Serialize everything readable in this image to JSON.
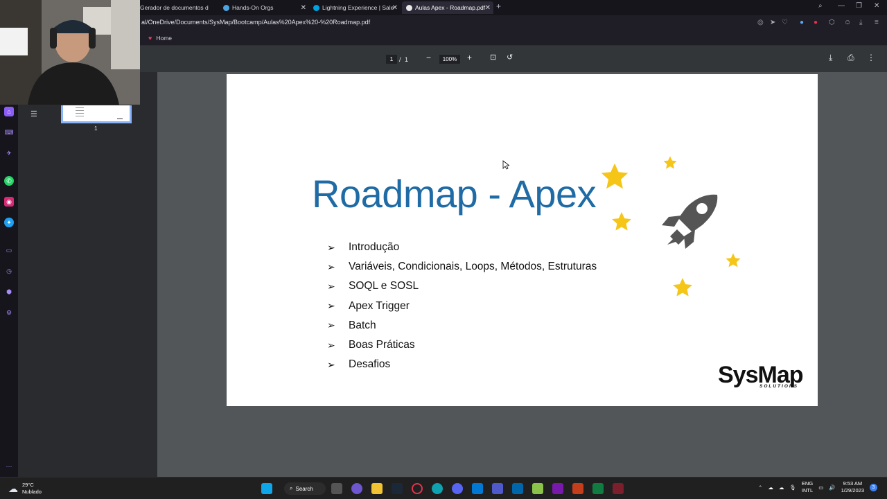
{
  "browser": {
    "tabs": [
      {
        "label": "Gerador de documentos d",
        "active": false
      },
      {
        "label": "Hands-On Orgs",
        "active": false
      },
      {
        "label": "Lightning Experience | Sale",
        "active": false
      },
      {
        "label": "Aulas Apex - Roadmap.pdf",
        "active": true
      }
    ],
    "new_tab_glyph": "+",
    "url": "al/OneDrive/Documents/SysMap/Bootcamp/Aulas%20Apex%20-%20Roadmap.pdf",
    "bookmark_home": "Home"
  },
  "pdf_toolbar": {
    "page_current": "1",
    "page_sep": "/",
    "page_total": "1",
    "zoom": "100%",
    "zoom_out": "−",
    "zoom_in": "+"
  },
  "thumbnail": {
    "page_label": "1"
  },
  "slide": {
    "title": "Roadmap - Apex",
    "bullet_glyph": "➢",
    "items": [
      "Introdução",
      "Variáveis, Condicionais, Loops, Métodos, Estruturas",
      "SOQL e SOSL",
      "Apex Trigger",
      "Batch",
      "Boas Práticas",
      "Desafios"
    ],
    "logo": "SysMap",
    "logo_sub": "SOLUTIONS"
  },
  "taskbar": {
    "temperature": "29°C",
    "weather": "Nublado",
    "search": "Search",
    "lang_top": "ENG",
    "lang_bottom": "INTL",
    "time": "9:53 AM",
    "date": "1/29/2023",
    "notifications": "3"
  },
  "colors": {
    "title_blue": "#1f6ba5",
    "star_yellow": "#f5c518",
    "pdf_toolbar": "#323639",
    "pdf_background": "#525659"
  }
}
